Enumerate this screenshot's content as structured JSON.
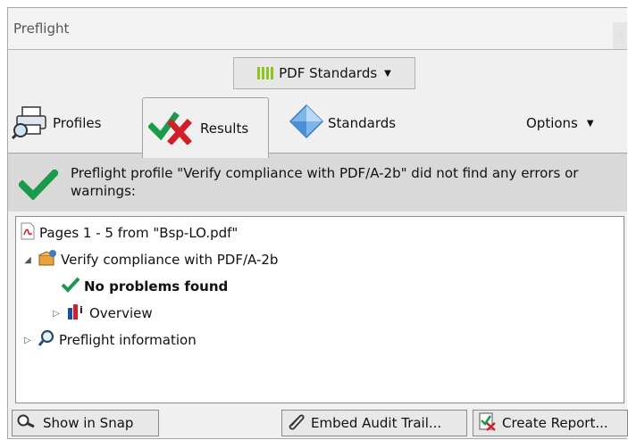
{
  "window": {
    "title": "Preflight"
  },
  "standards_dropdown": {
    "label": "PDF Standards",
    "icon": "bars-icon"
  },
  "tabs": [
    {
      "label": "Profiles",
      "icon": "printer-search-icon",
      "selected": false
    },
    {
      "label": "Results",
      "icon": "check-cross-icon",
      "selected": true
    },
    {
      "label": "Standards",
      "icon": "diamond-icon",
      "selected": false
    }
  ],
  "options": {
    "label": "Options"
  },
  "message": {
    "text": "Preflight profile \"Verify compliance with PDF/A-2b\" did not find any errors or warnings:",
    "icon": "green-check-icon"
  },
  "tree": {
    "root": {
      "label": "Pages 1 - 5 from \"Bsp-LO.pdf\"",
      "icon": "pdf-file-icon"
    },
    "profile": {
      "label": "Verify compliance with PDF/A-2b",
      "icon": "profile-box-icon",
      "expanded": true
    },
    "result": {
      "label": "No problems found",
      "icon": "green-check-icon"
    },
    "overview": {
      "label": "Overview",
      "icon": "overview-chart-icon",
      "expanded": false
    },
    "info": {
      "label": "Preflight information",
      "icon": "magnifier-icon",
      "expanded": false
    }
  },
  "footer": {
    "show_snap": "Show in Snap",
    "embed_audit": "Embed Audit Trail...",
    "create_report": "Create Report..."
  },
  "colors": {
    "accent_green": "#1a9a4b",
    "cross_red": "#d0202a"
  }
}
